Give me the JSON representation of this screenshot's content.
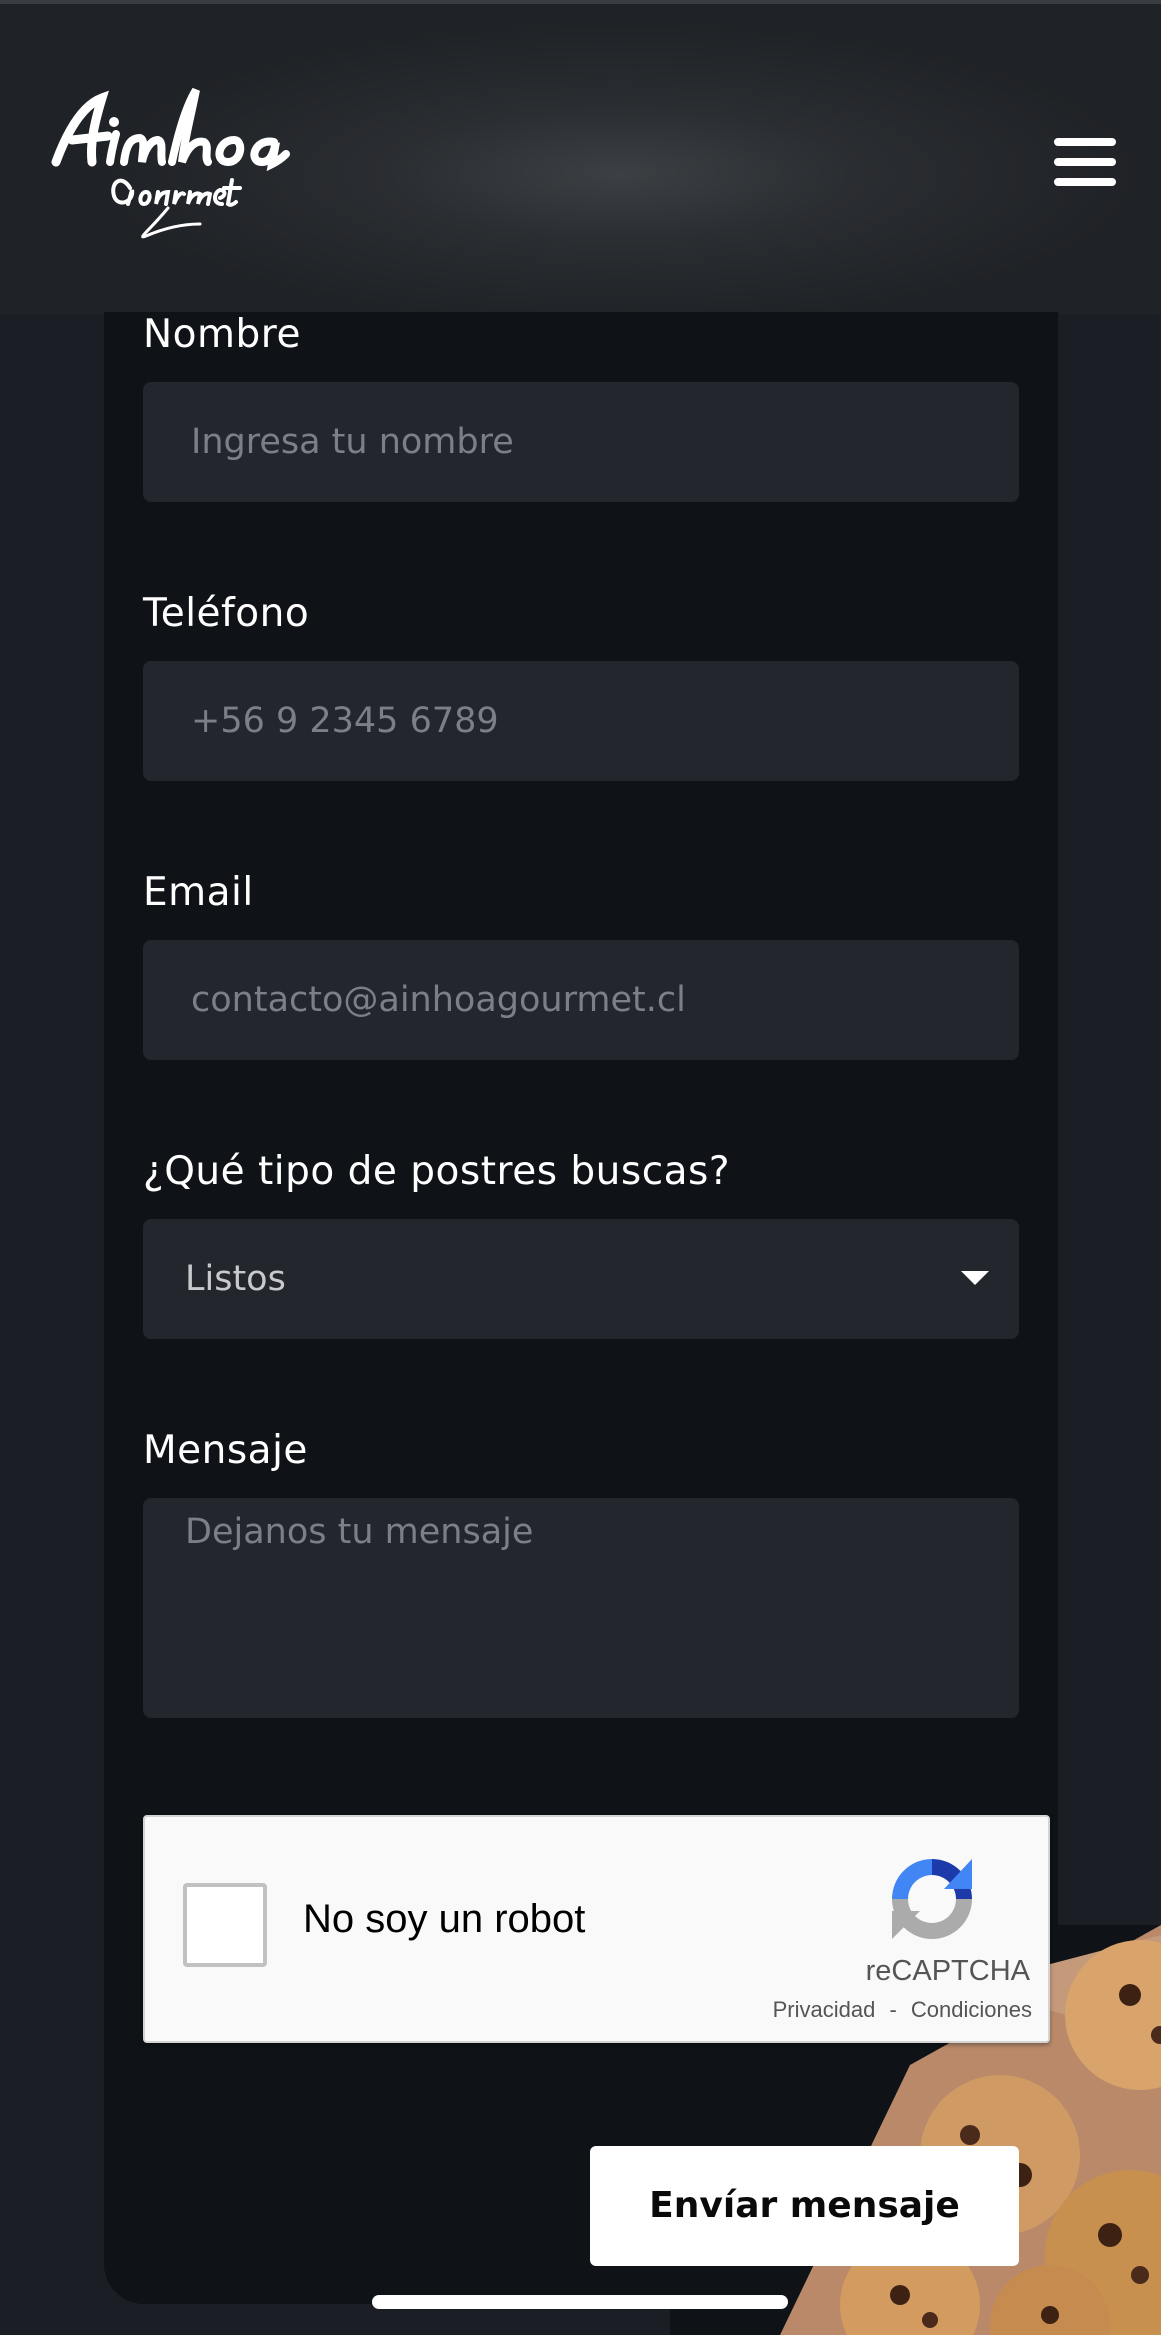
{
  "header": {
    "logo": {
      "text": "Ainhoa",
      "subtext": "Gourmet"
    },
    "menu_icon": "hamburger-menu-icon"
  },
  "form": {
    "name": {
      "label": "Nombre",
      "placeholder": "Ingresa tu nombre"
    },
    "phone": {
      "label": "Teléfono",
      "placeholder": "+56 9 2345 6789"
    },
    "email": {
      "label": "Email",
      "placeholder": "contacto@ainhoagourmet.cl"
    },
    "dessert_type": {
      "label": "¿Qué tipo de postres buscas?",
      "value": "Listos"
    },
    "message": {
      "label": "Mensaje",
      "placeholder": "Dejanos tu mensaje"
    },
    "submit_label": "Envíar mensaje"
  },
  "recaptcha": {
    "label": "No soy un robot",
    "brand": "reCAPTCHA",
    "privacy": "Privacidad",
    "separator": "-",
    "terms": "Condiciones"
  },
  "colors": {
    "background": "#1b1f25",
    "panel": "#0f1216",
    "field": "#23262d",
    "placeholder": "#7b7f86",
    "button": "#ffffff"
  }
}
